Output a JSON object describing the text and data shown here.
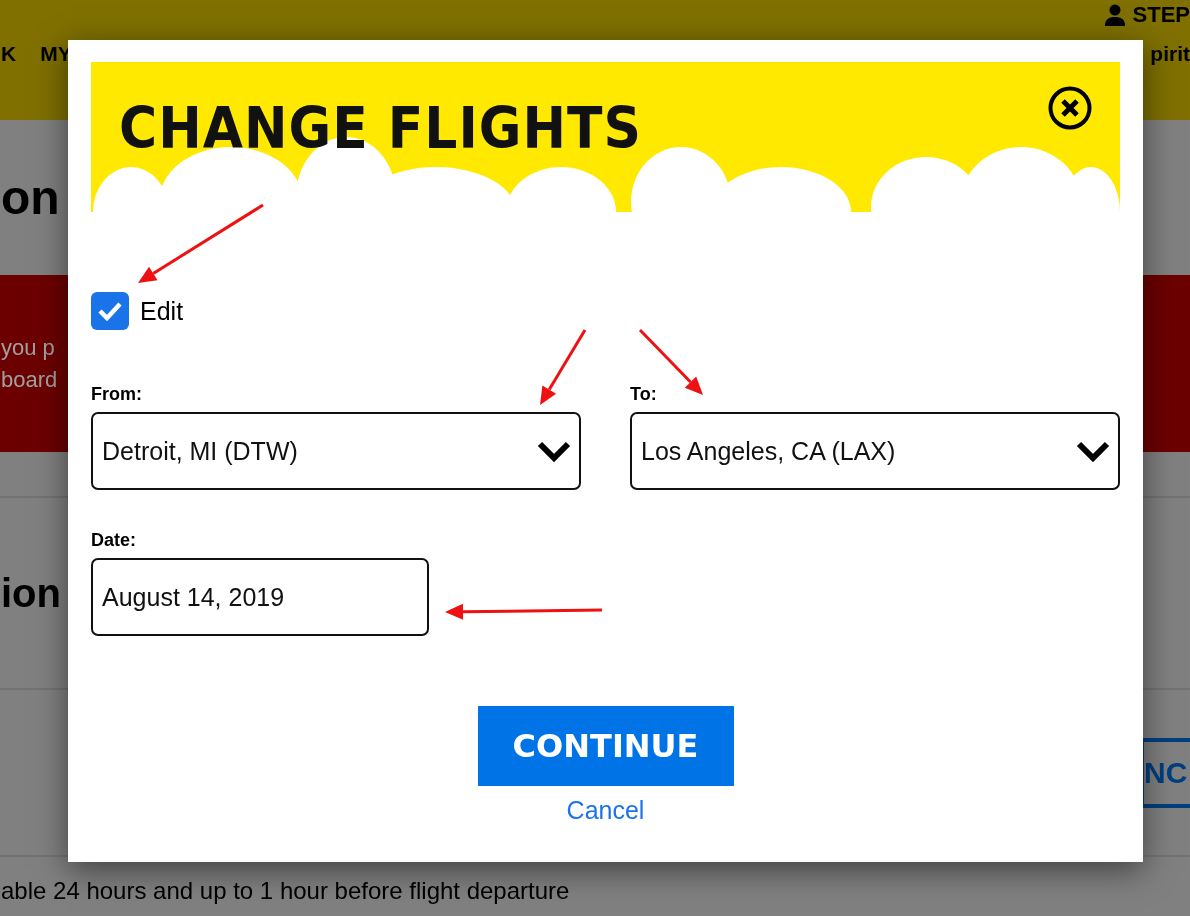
{
  "background": {
    "header": {
      "account_name": "STEP",
      "nav_items": [
        "K",
        "MY"
      ],
      "right_text": "pirit"
    },
    "heading_1": "on",
    "alert": {
      "lines": [
        "you p",
        "board"
      ]
    },
    "heading_2": "ion",
    "button_label": "NC",
    "footer_text": "able 24 hours and up to 1 hour before flight departure"
  },
  "dialog": {
    "title": "CHANGE FLIGHTS",
    "edit": {
      "label": "Edit",
      "checked": true
    },
    "from": {
      "label": "From:",
      "value": "Detroit, MI (DTW)"
    },
    "to": {
      "label": "To:",
      "value": "Los Angeles, CA (LAX)"
    },
    "date": {
      "label": "Date:",
      "value": "August 14, 2019"
    },
    "primary_button": "CONTINUE",
    "cancel_link": "Cancel"
  }
}
